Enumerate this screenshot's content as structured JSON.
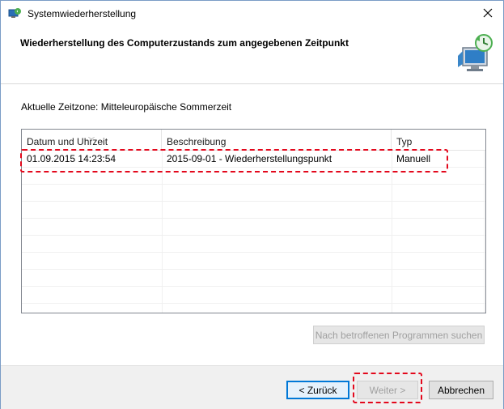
{
  "window": {
    "title": "Systemwiederherstellung",
    "close_glyph": "✕"
  },
  "header": {
    "title": "Wiederherstellung des Computerzustands zum angegebenen Zeitpunkt",
    "icon": "system-restore-monitor-icon"
  },
  "timezone_label": "Aktuelle Zeitzone: Mitteleuropäische Sommerzeit",
  "restore_list": {
    "columns": [
      "Datum und Uhrzeit",
      "Beschreibung",
      "Typ"
    ],
    "sorted_column": "Datum und Uhrzeit",
    "rows": [
      {
        "date": "01.09.2015 14:23:54",
        "description": "2015-09-01 - Wiederherstellungspunkt",
        "type": "Manuell"
      }
    ]
  },
  "buttons": {
    "scan_programs": "Nach betroffenen Programmen suchen",
    "back": "< Zurück",
    "next": "Weiter >",
    "cancel": "Abbrechen"
  },
  "colors": {
    "highlight": "#e3081c",
    "accent": "#0078d7"
  }
}
